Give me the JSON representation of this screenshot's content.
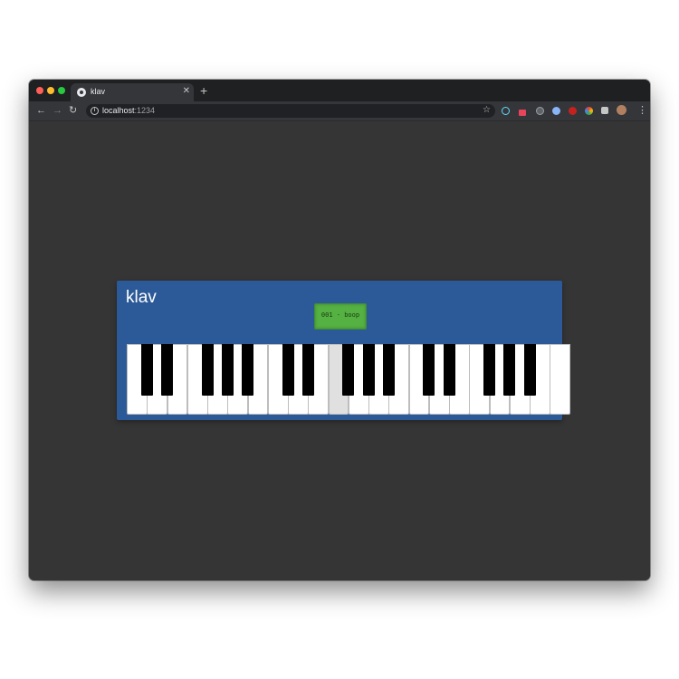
{
  "browser": {
    "tab_title": "klav",
    "tab_close_icon": "✕",
    "new_tab_icon": "+",
    "url_host": "localhost",
    "url_port": ":1234",
    "nav": {
      "back_icon": "←",
      "forward_icon": "→",
      "reload_icon": "↻"
    },
    "star_icon": "☆",
    "menu_icon": "⋮",
    "traffic_lights": {
      "close": "#ff5f57",
      "minimize": "#febc2e",
      "maximize": "#28c840"
    },
    "extensions": [
      {
        "name": "react-devtools-icon",
        "color": "#61dafb"
      },
      {
        "name": "pen-extension-icon",
        "color": "#e8445a"
      },
      {
        "name": "circle-extension-icon",
        "color": "#9aa0a6"
      },
      {
        "name": "color-picker-icon",
        "color": "#8ab4f8"
      },
      {
        "name": "ublock-icon",
        "color": "#c5221f"
      },
      {
        "name": "rainbow-extension-icon",
        "color": "#f9ab00"
      },
      {
        "name": "puzzle-icon",
        "color": "#c4c7c5"
      },
      {
        "name": "profile-avatar",
        "color": "#b08060"
      }
    ]
  },
  "app": {
    "title": "klav",
    "lcd": "001 - boop",
    "panel_color": "#2c5a98",
    "lcd_color": "#54b142",
    "keyboard": {
      "white_keys": 22,
      "pressed_white_key_index": 10,
      "black_keys_after_white": [
        0,
        1,
        3,
        4,
        5,
        7,
        8,
        10,
        11,
        12,
        14,
        15,
        17,
        18,
        19
      ]
    }
  }
}
